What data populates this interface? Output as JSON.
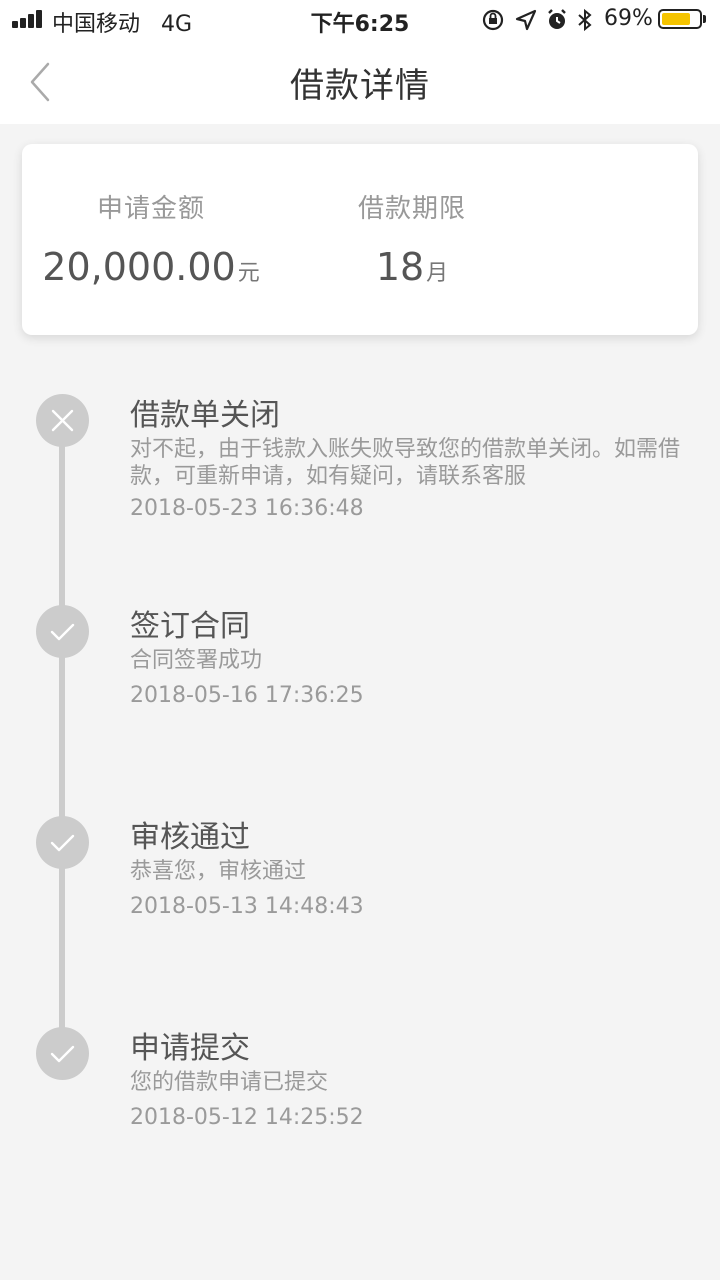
{
  "status_bar": {
    "carrier": "中国移动",
    "network": "4G",
    "time": "下午6:25",
    "battery_percent": "69%",
    "battery_color": "#f5c400"
  },
  "nav": {
    "back_icon": "chevron-left-icon",
    "title": "借款详情"
  },
  "summary": {
    "amount_label": "申请金额",
    "amount_value": "20,000.00",
    "amount_unit": "元",
    "term_label": "借款期限",
    "term_value": "18",
    "term_unit": "月"
  },
  "timeline": {
    "line_color": "#cccccc",
    "items": [
      {
        "icon": "close-icon",
        "title": "借款单关闭",
        "desc": "对不起，由于钱款入账失败导致您的借款单关闭。如需借款，可重新申请，如有疑问，请联系客服",
        "time": "2018-05-23 16:36:48"
      },
      {
        "icon": "check-icon",
        "title": "签订合同",
        "desc": "合同签署成功",
        "time": "2018-05-16 17:36:25"
      },
      {
        "icon": "check-icon",
        "title": "审核通过",
        "desc": "恭喜您，审核通过",
        "time": "2018-05-13 14:48:43"
      },
      {
        "icon": "check-icon",
        "title": "申请提交",
        "desc": "您的借款申请已提交",
        "time": "2018-05-12 14:25:52"
      }
    ]
  }
}
